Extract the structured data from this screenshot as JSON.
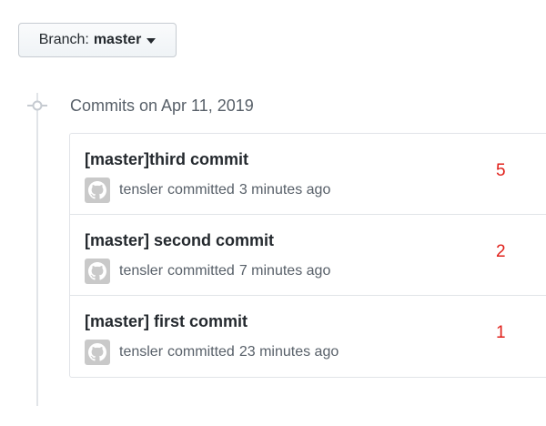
{
  "branch": {
    "label": "Branch:",
    "name": "master"
  },
  "commit_group": {
    "date_heading": "Commits on Apr 11, 2019",
    "commits": [
      {
        "title": "[master]third commit",
        "author": "tensler",
        "action": "committed",
        "time": "3 minutes ago",
        "annotation": "5"
      },
      {
        "title": "[master] second commit",
        "author": "tensler",
        "action": "committed",
        "time": "7 minutes ago",
        "annotation": "2"
      },
      {
        "title": "[master] first commit",
        "author": "tensler",
        "action": "committed",
        "time": "23 minutes ago",
        "annotation": "1"
      }
    ]
  },
  "colors": {
    "annotation": "#e0201a",
    "border": "#e1e4e8",
    "muted": "#586069"
  },
  "icons": {
    "avatar": "github-octocat-icon",
    "timeline": "git-commit-icon",
    "dropdown": "caret-down-icon"
  }
}
